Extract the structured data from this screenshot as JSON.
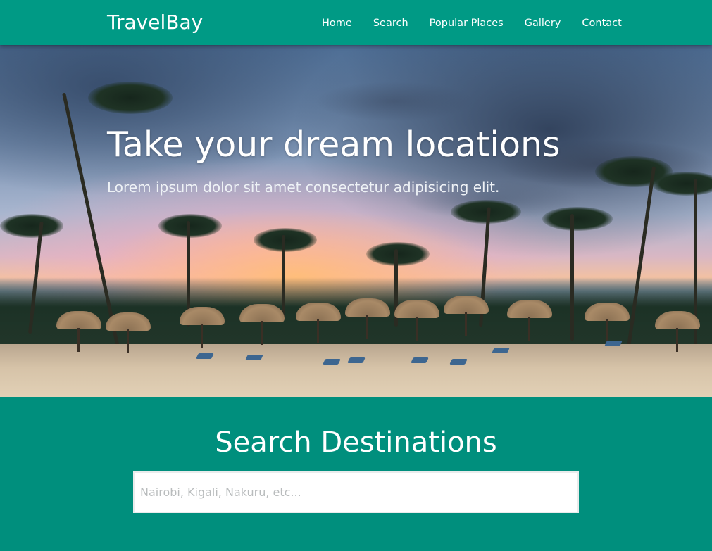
{
  "header": {
    "brand": "TravelBay",
    "nav": [
      "Home",
      "Search",
      "Popular Places",
      "Gallery",
      "Contact"
    ]
  },
  "hero": {
    "title": "Take your dream locations",
    "subtitle": "Lorem ipsum dolor sit amet consectetur adipisicing elit."
  },
  "search": {
    "title": "Search Destinations",
    "placeholder": "Nairobi, Kigali, Nakuru, etc..."
  },
  "colors": {
    "header_bg": "#009a85",
    "section_bg": "#008f7d",
    "text": "#ffffff"
  }
}
